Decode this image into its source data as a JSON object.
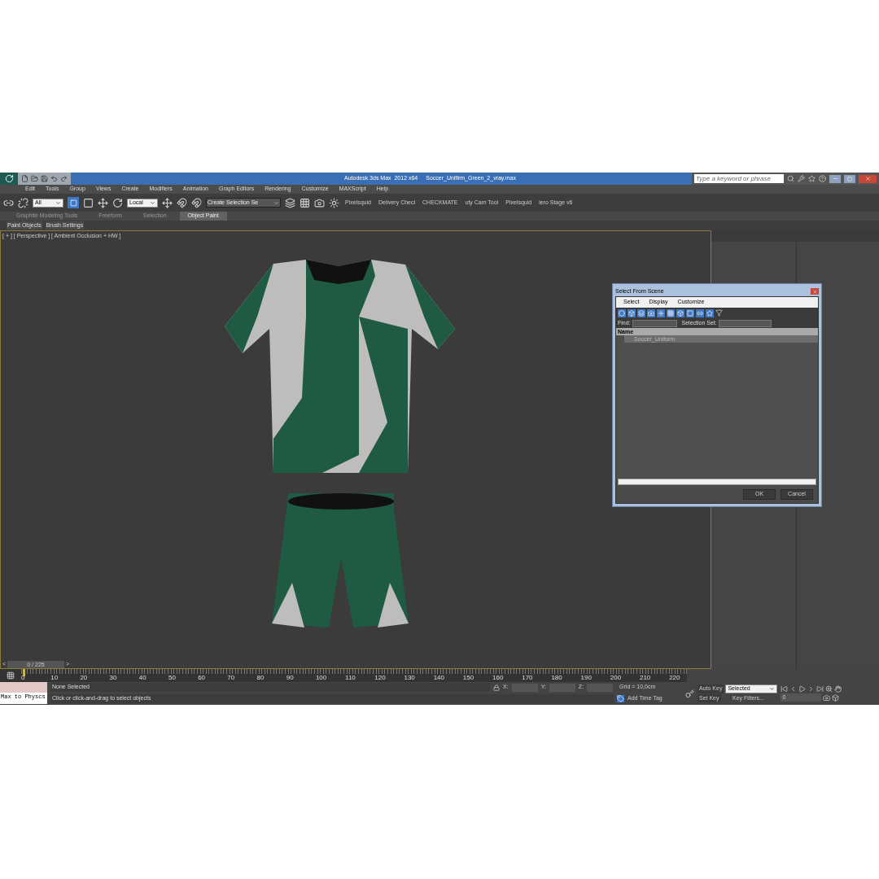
{
  "title_bar": {
    "app_title": "Autodesk 3ds Max  2012 x64",
    "file_name": "Soccer_Unifirm_Green_2_vray.max",
    "search": {
      "placeholder": "Type a keyword or phrase"
    }
  },
  "menu": [
    "Edit",
    "Tools",
    "Group",
    "Views",
    "Create",
    "Modifiers",
    "Animation",
    "Graph Editors",
    "Rendering",
    "Customize",
    "MAXScript",
    "Help"
  ],
  "toolbar": {
    "selection_filter": "All",
    "coordinate_system": "Local",
    "named_selection": "Create Selection Se",
    "script_buttons": [
      "Pixelsquid",
      "Delivery Checl",
      "CHECKMATE",
      "uty Cam Tool",
      "Pixelsquid",
      "lero Stage v6"
    ]
  },
  "ribbon": {
    "tabs": [
      {
        "label": "Graphite Modeling Tools",
        "selected": false
      },
      {
        "label": "Freeform",
        "selected": false
      },
      {
        "label": "Selection",
        "selected": false
      },
      {
        "label": "Object Paint",
        "selected": true
      }
    ],
    "panels": [
      "Paint Objects",
      "Brush Settings"
    ]
  },
  "viewport": {
    "label": "[ + ] [ Perspective ] [ Ambient Occlusion + HW ]"
  },
  "time_slider": {
    "prev": "<",
    "frame": "0 / 225",
    "next": ">"
  },
  "track_bar": {
    "ticks": [
      "0",
      "10",
      "20",
      "30",
      "40",
      "50",
      "60",
      "70",
      "80",
      "90",
      "100",
      "110",
      "120",
      "130",
      "140",
      "150",
      "160",
      "170",
      "180",
      "190",
      "200",
      "210",
      "220"
    ]
  },
  "status": {
    "script_listener": "Max to Physcs",
    "selection": "None Selected",
    "prompt": "Click or click-and-drag to select objects",
    "x_label": "X:",
    "y_label": "Y:",
    "z_label": "Z:",
    "grid": "Grid = 10,0cm",
    "add_time_tag": "Add Time Tag"
  },
  "animation": {
    "auto_key": "Auto Key",
    "set_key": "Set Key",
    "key_mode": "Selected",
    "key_filters": "Key Filters...",
    "frame": "0"
  },
  "dialog": {
    "title": "Select From Scene",
    "menu": [
      "Select",
      "Display",
      "Customize"
    ],
    "find_label": "Find:",
    "selection_set_label": "Selection Set:",
    "column": "Name",
    "items": [
      {
        "name": "Soccer_Uniform",
        "selected": true
      }
    ],
    "buttons": [
      "OK",
      "Cancel"
    ]
  }
}
